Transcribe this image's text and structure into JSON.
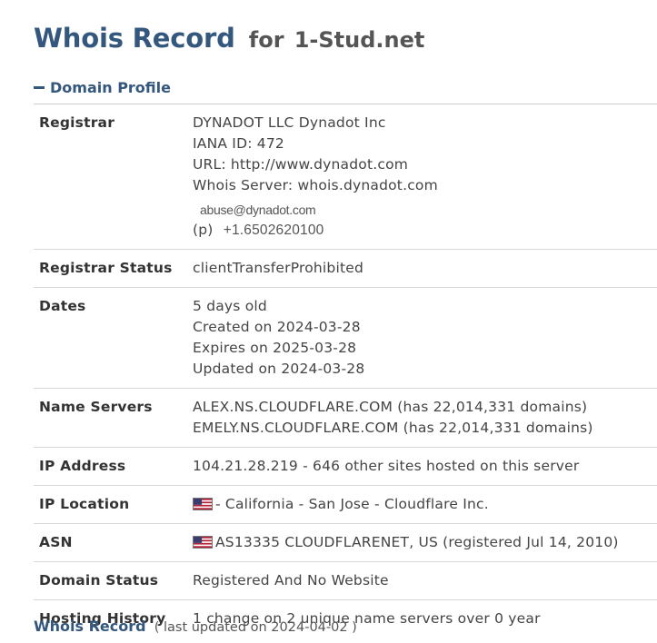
{
  "header": {
    "title_main": "Whois Record",
    "title_for": "for",
    "title_domain": "1-Stud.net"
  },
  "section": {
    "label": "Domain Profile",
    "toggle_icon": "minus-icon"
  },
  "profile": {
    "registrar": {
      "label": "Registrar",
      "name": "DYNADOT LLC Dynadot Inc",
      "iana": "IANA ID: 472",
      "url": "URL: http://www.dynadot.com",
      "whois_server": "Whois Server: whois.dynadot.com",
      "email": "abuse@dynadot.com",
      "phone_label": "(p)",
      "phone": "+1.6502620100"
    },
    "registrar_status": {
      "label": "Registrar Status",
      "value": "clientTransferProhibited"
    },
    "dates": {
      "label": "Dates",
      "age": "5 days old",
      "created": "Created on 2024-03-28",
      "expires": "Expires on 2025-03-28",
      "updated": "Updated on 2024-03-28"
    },
    "name_servers": {
      "label": "Name Servers",
      "ns1": "ALEX.NS.CLOUDFLARE.COM (has 22,014,331 domains)",
      "ns2": "EMELY.NS.CLOUDFLARE.COM (has 22,014,331 domains)"
    },
    "ip_address": {
      "label": "IP Address",
      "value": "104.21.28.219 - 646 other sites hosted on this server"
    },
    "ip_location": {
      "label": "IP Location",
      "flag_icon": "us-flag-icon",
      "value": "- California - San Jose - Cloudflare Inc."
    },
    "asn": {
      "label": "ASN",
      "flag_icon": "us-flag-icon",
      "value": "AS13335 CLOUDFLARENET, US (registered Jul 14, 2010)"
    },
    "domain_status": {
      "label": "Domain Status",
      "value": "Registered And No Website"
    },
    "hosting_history": {
      "label": "Hosting History",
      "value": "1 change on 2 unique name servers over 0 year"
    }
  },
  "footer": {
    "title": "Whois Record",
    "updated": "( last updated on 2024-04-02 )"
  },
  "colors": {
    "accent": "#34577e",
    "text": "#333333",
    "rule": "#d8d8d8"
  }
}
